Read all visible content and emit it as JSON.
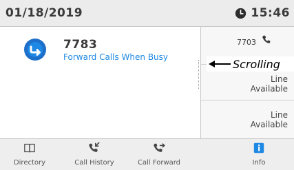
{
  "header": {
    "date": "01/18/2019",
    "time": "15:46",
    "time_icon": "clock-icon"
  },
  "main": {
    "line_number": "7783",
    "status": "Forward Calls When Busy",
    "status_icon": "call-forward-badge-icon"
  },
  "line_keys": [
    {
      "number": "7703",
      "icon": "phone-handset-icon",
      "text_line1": "",
      "text_line2": ""
    },
    {
      "number": "",
      "icon": "",
      "text_line1": "Line",
      "text_line2": "Available"
    },
    {
      "number": "",
      "icon": "",
      "text_line1": "Line",
      "text_line2": "Available"
    }
  ],
  "callout": {
    "label": "Scrolling"
  },
  "softkeys": [
    {
      "label": "Directory",
      "icon": "book-icon"
    },
    {
      "label": "Call History",
      "icon": "call-history-icon"
    },
    {
      "label": "Call Forward",
      "icon": "call-forward-icon"
    },
    {
      "label": "Info",
      "icon": "info-icon"
    }
  ],
  "colors": {
    "accent": "#1e88e5",
    "header_bg": "#ececec",
    "softkey_bg": "#eeeeee",
    "line_column_bg": "#f7f7f7"
  }
}
